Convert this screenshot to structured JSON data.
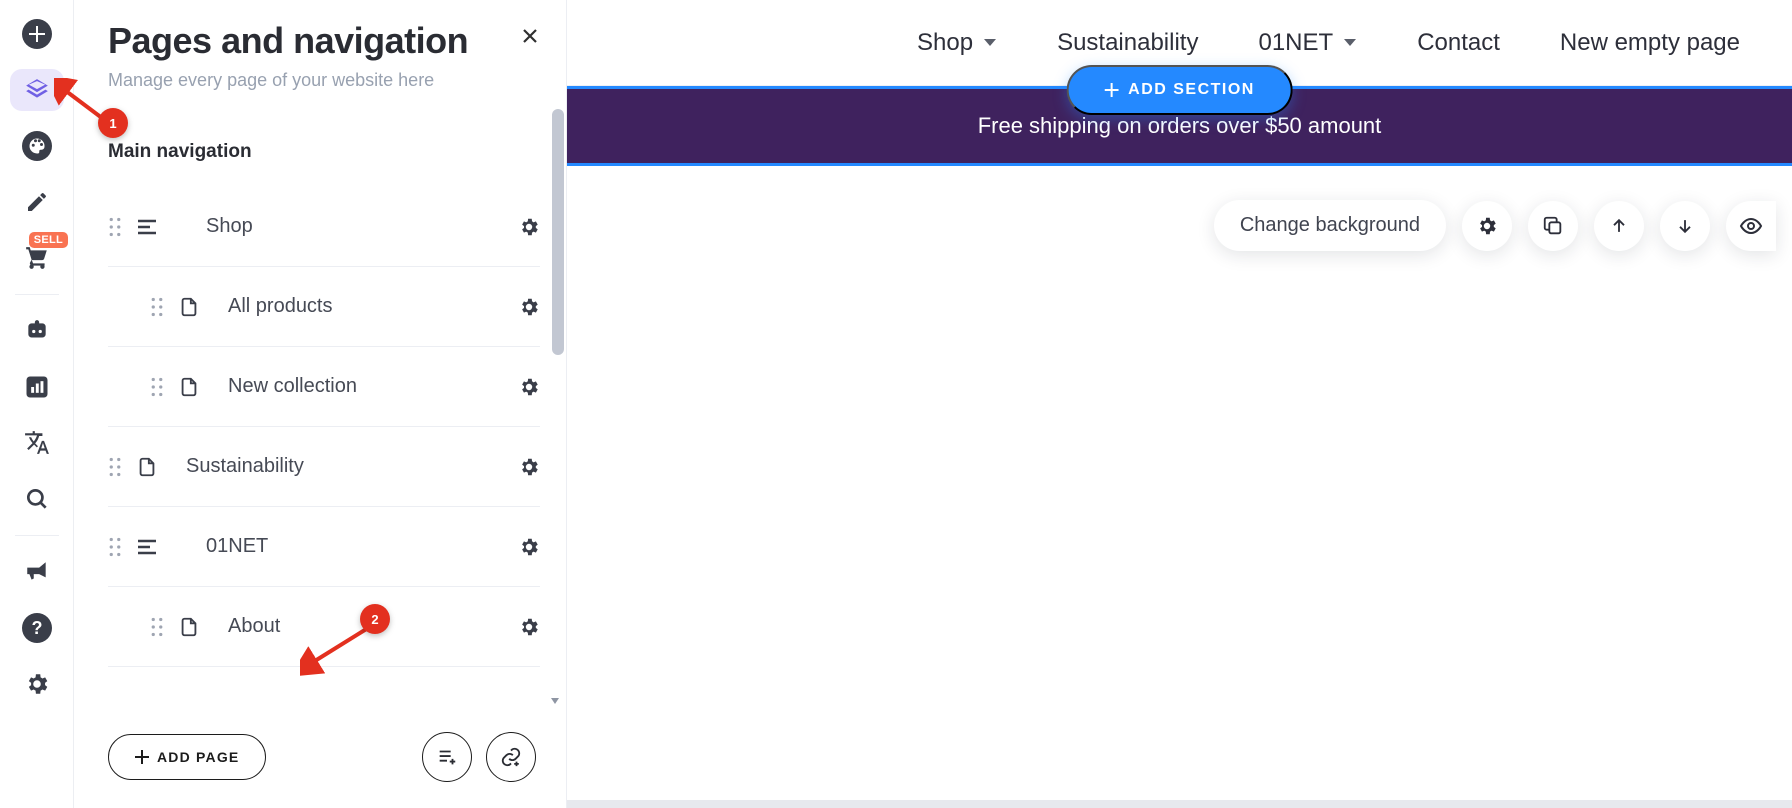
{
  "rail": {
    "sell_badge": "SELL"
  },
  "panel": {
    "title": "Pages and navigation",
    "subtitle": "Manage every page of your website here",
    "section": "Main navigation",
    "items": [
      {
        "label": "Shop",
        "kind": "section",
        "indent": 0
      },
      {
        "label": "All products",
        "kind": "page",
        "indent": 1
      },
      {
        "label": "New collection",
        "kind": "page",
        "indent": 1
      },
      {
        "label": "Sustainability",
        "kind": "page",
        "indent": 0
      },
      {
        "label": "01NET",
        "kind": "section",
        "indent": 0
      },
      {
        "label": "About",
        "kind": "page",
        "indent": 1
      }
    ],
    "add_page": "ADD PAGE"
  },
  "top_nav": {
    "items": [
      {
        "label": "Shop",
        "dropdown": true
      },
      {
        "label": "Sustainability",
        "dropdown": false
      },
      {
        "label": "01NET",
        "dropdown": true
      },
      {
        "label": "Contact",
        "dropdown": false
      },
      {
        "label": "New empty page",
        "dropdown": false
      }
    ]
  },
  "banner": {
    "message": "Free shipping on orders over $50 amount",
    "add_section": "ADD SECTION"
  },
  "toolbar": {
    "change_bg": "Change background"
  },
  "annotations": {
    "step1": "1",
    "step2": "2"
  }
}
